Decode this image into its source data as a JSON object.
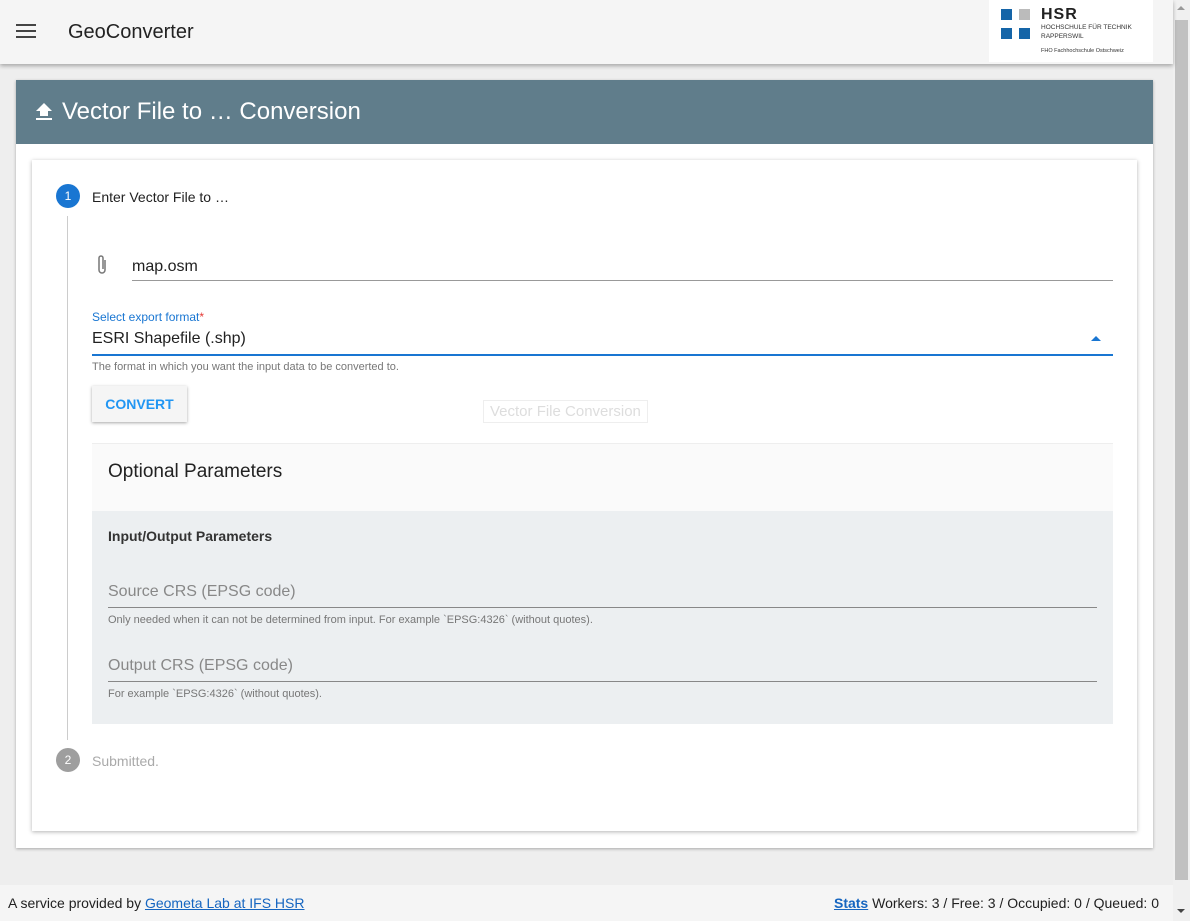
{
  "header": {
    "title": "GeoConverter",
    "logo": {
      "name": "HSR",
      "line1": "HOCHSCHULE FÜR TECHNIK",
      "line2": "RAPPERSWIL",
      "line3": "FHO Fachhochschule Ostschweiz"
    }
  },
  "card": {
    "title": "Vector File to … Conversion"
  },
  "steps": [
    {
      "number": "1",
      "label": "Enter Vector File to …"
    },
    {
      "number": "2",
      "label": "Submitted."
    }
  ],
  "form": {
    "file_value": "map.osm",
    "format_label": "Select export format",
    "format_required": "*",
    "format_value": "ESRI Shapefile (.shp)",
    "format_hint": "The format in which you want the input data to be converted to.",
    "convert_label": "CONVERT",
    "tooltip": "Vector File Conversion"
  },
  "optional": {
    "title": "Optional Parameters",
    "section": "Input/Output Parameters",
    "source_placeholder": "Source CRS (EPSG code)",
    "source_hint": "Only needed when it can not be determined from input. For example `EPSG:4326` (without quotes).",
    "output_placeholder": "Output CRS (EPSG code)",
    "output_hint": "For example `EPSG:4326` (without quotes)."
  },
  "footer": {
    "prefix": "A service provided by",
    "link": "Geometa Lab at IFS HSR",
    "stats_link": "Stats",
    "stats": "Workers: 3 / Free: 3 / Occupied: 0 / Queued: 0"
  },
  "colors": {
    "accent": "#1976d2",
    "header": "#607d8b"
  }
}
